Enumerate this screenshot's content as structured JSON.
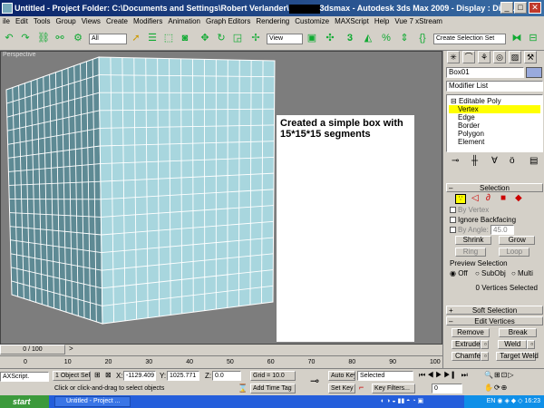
{
  "window": {
    "title_left": "Untitled   - Project Folder: C:\\Documents and Settings\\Robert Verlander\\",
    "title_right": "3dsmax     - Autodesk 3ds Max  2009          - Display : Direc...",
    "minimize": "_",
    "maximize": "□",
    "close": "✕"
  },
  "menubar": [
    "ile",
    "Edit",
    "Tools",
    "Group",
    "Views",
    "Create",
    "Modifiers",
    "Animation",
    "Graph Editors",
    "Rendering",
    "Customize",
    "MAXScript",
    "Help",
    "Vue 7 xStream"
  ],
  "toolbar": {
    "filter_dropdown": "All",
    "view_dropdown": "View",
    "selection_set": "Create Selection Set"
  },
  "viewport": {
    "label": "Perspective",
    "annotation": "Created a simple box with 15*15*15 segments",
    "segments": 15,
    "colors": {
      "box_face": "#a8d6de",
      "box_side": "#5e8a94",
      "grid_line": "#ffffff"
    }
  },
  "command_panel": {
    "object_name": "Box01",
    "modifier_list": "Modifier List",
    "stack": [
      {
        "label": "Editable Poly",
        "indent": 0
      },
      {
        "label": "Vertex",
        "indent": 1,
        "selected": true
      },
      {
        "label": "Edge",
        "indent": 1
      },
      {
        "label": "Border",
        "indent": 1
      },
      {
        "label": "Polygon",
        "indent": 1
      },
      {
        "label": "Element",
        "indent": 1
      }
    ],
    "selection": {
      "header": "Selection",
      "by_vertex": "By Vertex",
      "ignore_backfacing": "Ignore Backfacing",
      "by_angle": "By Angle:",
      "angle_value": "45.0",
      "shrink": "Shrink",
      "grow": "Grow",
      "ring": "Ring",
      "loop": "Loop",
      "preview_selection": "Preview Selection",
      "off": "Off",
      "subobj": "SubObj",
      "multi": "Multi",
      "status": "0 Vertices Selected"
    },
    "soft_selection": "Soft Selection",
    "edit_vertices": {
      "header": "Edit Vertices",
      "remove": "Remove",
      "break": "Break",
      "extrude": "Extrude",
      "weld": "Weld",
      "chamfer": "Chamfer",
      "target_weld": "Target Weld"
    }
  },
  "timeline": {
    "slider": "0 / 100",
    "ticks": [
      "0",
      "10",
      "20",
      "30",
      "40",
      "50",
      "60",
      "70",
      "80",
      "90",
      "100"
    ]
  },
  "status": {
    "objects": "1 Object Sele",
    "x_label": "X:",
    "x_value": "-1129.409",
    "y_label": "Y:",
    "y_value": "1025.771",
    "z_label": "Z:",
    "z_value": "0.0",
    "grid": "Grid = 10.0",
    "auto_key": "Auto Key",
    "selected": "Selected",
    "set_key": "Set Key",
    "key_filters": "Key Filters...",
    "frame": "0",
    "maxscript": "AXScript.",
    "prompt": "Click or click-and-drag to select objects",
    "add_time_tag": "Add Time Tag"
  },
  "taskbar": {
    "start": "start",
    "task1": "Untitled   - Project ...",
    "tray_lang": "EN",
    "clock": "16:23"
  }
}
